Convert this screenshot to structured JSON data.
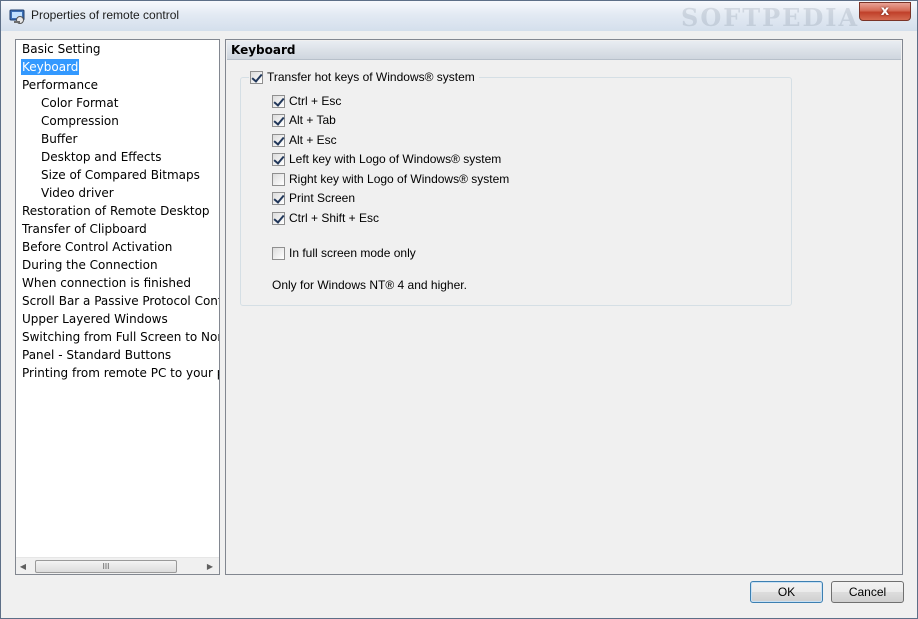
{
  "window": {
    "title": "Properties of remote control",
    "watermark": "SOFTPEDIA",
    "close_glyph": "x"
  },
  "tree": {
    "items": [
      {
        "label": "Basic Setting",
        "level": 0
      },
      {
        "label": "Keyboard",
        "level": 0,
        "selected": true
      },
      {
        "label": "Performance",
        "level": 0
      },
      {
        "label": "Color Format",
        "level": 1
      },
      {
        "label": "Compression",
        "level": 1
      },
      {
        "label": "Buffer",
        "level": 1
      },
      {
        "label": "Desktop and Effects",
        "level": 1
      },
      {
        "label": "Size of Compared Bitmaps",
        "level": 1
      },
      {
        "label": "Video driver",
        "level": 1
      },
      {
        "label": "Restoration of Remote Desktop",
        "level": 0
      },
      {
        "label": "Transfer of Clipboard",
        "level": 0
      },
      {
        "label": "Before Control Activation",
        "level": 0
      },
      {
        "label": "During the Connection",
        "level": 0
      },
      {
        "label": "When connection is finished",
        "level": 0
      },
      {
        "label": "Scroll Bar a Passive Protocol Control",
        "level": 0
      },
      {
        "label": "Upper Layered Windows",
        "level": 0
      },
      {
        "label": "Switching from Full Screen to Normal",
        "level": 0
      },
      {
        "label": "Panel - Standard Buttons",
        "level": 0
      },
      {
        "label": "Printing from remote PC to your printer",
        "level": 0
      }
    ],
    "scroll_thumb_glyph": "III"
  },
  "page": {
    "title": "Keyboard",
    "group": {
      "label": "Transfer hot keys of Windows® system",
      "checked": true
    },
    "options": [
      {
        "label": "Ctrl + Esc",
        "checked": true
      },
      {
        "label": "Alt + Tab",
        "checked": true
      },
      {
        "label": "Alt + Esc",
        "checked": true
      },
      {
        "label": "Left key with Logo of Windows® system",
        "checked": true
      },
      {
        "label": "Right key with Logo of Windows® system",
        "checked": false
      },
      {
        "label": "Print Screen",
        "checked": true
      },
      {
        "label": "Ctrl + Shift + Esc",
        "checked": true
      }
    ],
    "fullscreen_only": {
      "label": "In full screen mode only",
      "checked": false
    },
    "note": "Only for Windows NT® 4 and higher."
  },
  "buttons": {
    "ok": "OK",
    "cancel": "Cancel"
  }
}
